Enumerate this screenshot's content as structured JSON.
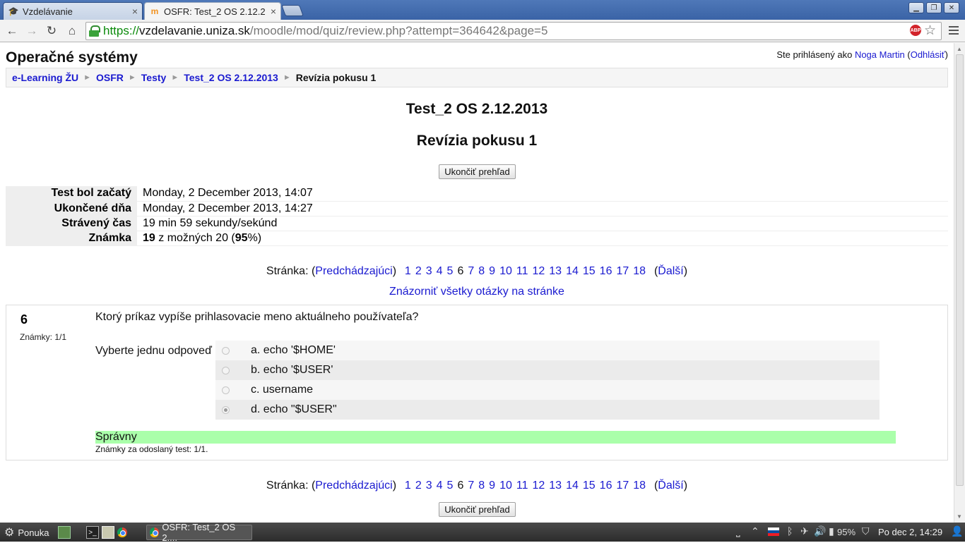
{
  "browser": {
    "tabs": [
      {
        "title": "Vzdelávanie",
        "favicon": "graduation-cap-icon"
      },
      {
        "title": "OSFR: Test_2 OS 2.12.2",
        "favicon": "moodle-icon"
      }
    ],
    "url": {
      "scheme": "https://",
      "host": "vzdelavanie.uniza.sk",
      "path": "/moodle/mod/quiz/review.php?attempt=364642&page=5"
    },
    "abp_label": "ABP"
  },
  "page": {
    "site_title": "Operačné systémy",
    "login": {
      "prefix": "Ste prihlásený ako",
      "user": "Noga Martin",
      "logout": "Odhlásiť"
    },
    "breadcrumb": [
      "e-Learning ŽU",
      "OSFR",
      "Testy",
      "Test_2 OS 2.12.2013",
      "Revízia pokusu 1"
    ],
    "heading": "Test_2 OS 2.12.2013",
    "subheading": "Revízia pokusu 1",
    "finish_button": "Ukončiť prehľad",
    "summary": [
      {
        "label": "Test bol začatý",
        "value": "Monday, 2 December 2013, 14:07"
      },
      {
        "label": "Ukončené dňa",
        "value": "Monday, 2 December 2013, 14:27"
      },
      {
        "label": "Strávený čas",
        "value": "19 min 59 sekundy/sekúnd"
      }
    ],
    "grade": {
      "label": "Známka",
      "score": "19",
      "middle": "z možných 20 (",
      "percent": "95",
      "tail": "%)"
    },
    "pager": {
      "label": "Stránka:",
      "prev": "Predchádzajúci",
      "next": "Ďalší",
      "pages": [
        "1",
        "2",
        "3",
        "4",
        "5",
        "6",
        "7",
        "8",
        "9",
        "10",
        "11",
        "12",
        "13",
        "14",
        "15",
        "16",
        "17",
        "18"
      ],
      "current": "6"
    },
    "show_all": "Znázorniť všetky otázky na stránke",
    "question": {
      "number": "6",
      "grade": "Známky: 1/1",
      "text": "Ktorý príkaz vypíše prihlasovacie meno aktuálneho používateľa?",
      "prompt": "Vyberte jednu odpoveď",
      "answers": [
        {
          "text": "a. echo '$HOME'",
          "checked": false
        },
        {
          "text": "b. echo '$USER'",
          "checked": false
        },
        {
          "text": "c. username",
          "checked": false
        },
        {
          "text": "d. echo \"$USER\"",
          "checked": true
        }
      ],
      "outcome": "Správny",
      "outcome_note": "Známky za odoslaný test: 1/1."
    }
  },
  "taskbar": {
    "menu_label": "Ponuka",
    "window_title": "OSFR: Test_2 OS 2....",
    "battery": "95%",
    "clock": "Po dec  2, 14:29"
  }
}
